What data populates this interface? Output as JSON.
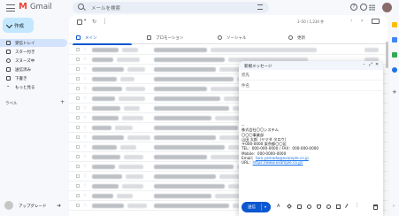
{
  "header": {
    "app_name": "Gmail",
    "search_placeholder": "メールを検索"
  },
  "sidebar": {
    "compose_label": "作成",
    "items": [
      {
        "label": "受信トレイ",
        "count": "",
        "active": true
      },
      {
        "label": "スター付き",
        "count": ""
      },
      {
        "label": "スヌーズ中",
        "count": ""
      },
      {
        "label": "送信済み",
        "count": ""
      },
      {
        "label": "下書き",
        "count": ""
      },
      {
        "label": "もっと見る",
        "count": ""
      }
    ],
    "labels_heading": "ラベル",
    "labels_add": "+",
    "bottom_label": "アップグレード"
  },
  "toolbar": {
    "pager_text": "1–50 / 1,234 件"
  },
  "tabs": [
    {
      "label": "メイン",
      "active": true
    },
    {
      "label": "プロモーション"
    },
    {
      "label": "ソーシャル"
    },
    {
      "label": "更新"
    }
  ],
  "compose_window": {
    "title": "新規メッセージ",
    "to_placeholder": "宛先",
    "subject_placeholder": "件名",
    "signature": [
      "--",
      "株式会社〇〇システム",
      "〇〇〇事業部",
      "山田 太郎（ヤマダ タロウ）",
      "〒000-0000 東京都〇〇区",
      "TEL：000-000-0000 / FAX：000-000-0000",
      "Mobile：000-0000-0000"
    ],
    "email_label": "Email：",
    "email_value": "taro.yamada@example.co.jp",
    "url_label": "URL：",
    "url_value": "https://www.example.co.jp/",
    "send_label": "送信"
  },
  "colors": {
    "accent": "#0b57d0",
    "active_nav": "#d3e3fd",
    "compose_button": "#c2e7ff",
    "background": "#f6f8fc"
  }
}
